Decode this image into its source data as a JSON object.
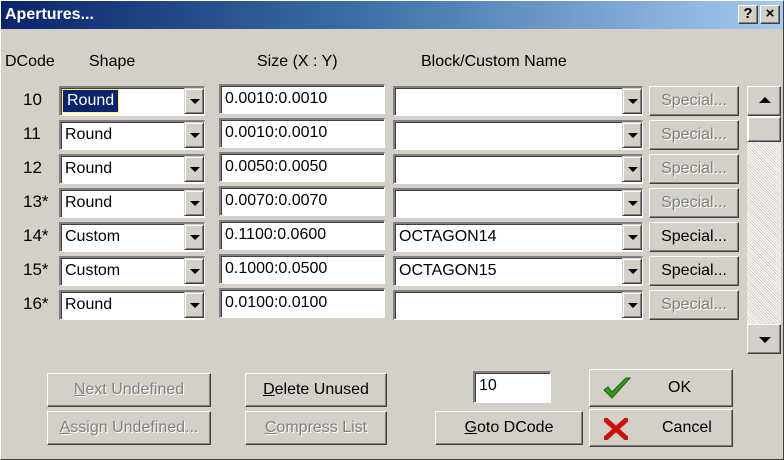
{
  "window": {
    "title": "Apertures...",
    "help_button": "?",
    "close_button": "×"
  },
  "headers": {
    "dcode": "DCode",
    "shape": "Shape",
    "size": "Size (X : Y)",
    "block": "Block/Custom Name"
  },
  "rows": [
    {
      "dcode": "10",
      "shape": "Round",
      "size": "0.0010:0.0010",
      "block": "",
      "special": "Special...",
      "special_enabled": false
    },
    {
      "dcode": "11",
      "shape": "Round",
      "size": "0.0010:0.0010",
      "block": "",
      "special": "Special...",
      "special_enabled": false
    },
    {
      "dcode": "12",
      "shape": "Round",
      "size": "0.0050:0.0050",
      "block": "",
      "special": "Special...",
      "special_enabled": false
    },
    {
      "dcode": "13*",
      "shape": "Round",
      "size": "0.0070:0.0070",
      "block": "",
      "special": "Special...",
      "special_enabled": false
    },
    {
      "dcode": "14*",
      "shape": "Custom",
      "size": "0.1100:0.0600",
      "block": "OCTAGON14",
      "special": "Special...",
      "special_enabled": true
    },
    {
      "dcode": "15*",
      "shape": "Custom",
      "size": "0.1000:0.0500",
      "block": "OCTAGON15",
      "special": "Special...",
      "special_enabled": true
    },
    {
      "dcode": "16*",
      "shape": "Round",
      "size": "0.0100:0.0100",
      "block": "",
      "special": "Special...",
      "special_enabled": false
    }
  ],
  "buttons": {
    "next_undefined": {
      "first": "N",
      "rest": "ext Undefined"
    },
    "assign_undefined": {
      "first": "A",
      "rest": "ssign Undefined..."
    },
    "delete_unused": {
      "first": "D",
      "rest": "elete Unused"
    },
    "compress_list": {
      "first": "C",
      "rest": "ompress List"
    },
    "goto_dcode": {
      "first": "G",
      "rest": "oto DCode"
    },
    "ok": "OK",
    "cancel": "Cancel"
  },
  "goto_input_value": "10",
  "colors": {
    "ok_check": "#3a9a1a",
    "cancel_x": "#cc1010",
    "title_bar": "#0a246a"
  }
}
